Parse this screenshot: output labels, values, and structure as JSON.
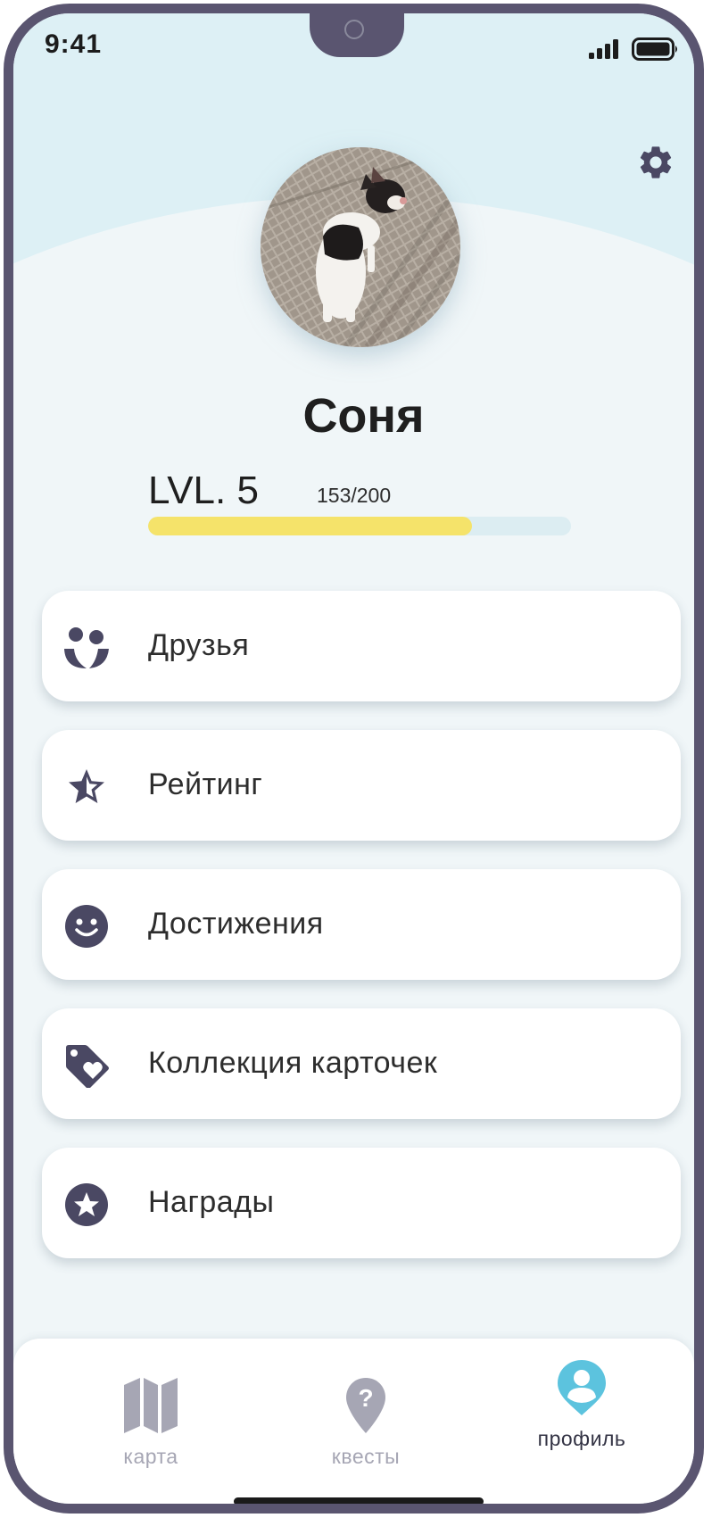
{
  "status_bar": {
    "time": "9:41"
  },
  "profile": {
    "name": "Соня",
    "level_label": "LVL. 5",
    "xp_text": "153/200",
    "xp_progress": 0.765
  },
  "menu": [
    {
      "label": "Друзья",
      "icon": "friends-icon"
    },
    {
      "label": "Рейтинг",
      "icon": "half-star-icon"
    },
    {
      "label": "Достижения",
      "icon": "smiley-icon"
    },
    {
      "label": "Коллекция карточек",
      "icon": "tag-heart-icon"
    },
    {
      "label": "Награды",
      "icon": "star-badge-icon"
    }
  ],
  "tabbar": {
    "map": {
      "label": "карта",
      "icon": "map-icon"
    },
    "quests": {
      "label": "квесты",
      "icon": "question-pin-icon"
    },
    "profile": {
      "label": "профиль",
      "icon": "profile-pin-icon",
      "active": true
    }
  },
  "colors": {
    "frame": "#5a5570",
    "header_bg": "#ddf0f5",
    "screen_bg": "#f0f6f8",
    "xp_fill": "#f5e36a",
    "xp_track": "#dcedf2",
    "icon": "#4a4863",
    "accent": "#5cc3de",
    "tab_inactive": "#a6a6b4"
  }
}
